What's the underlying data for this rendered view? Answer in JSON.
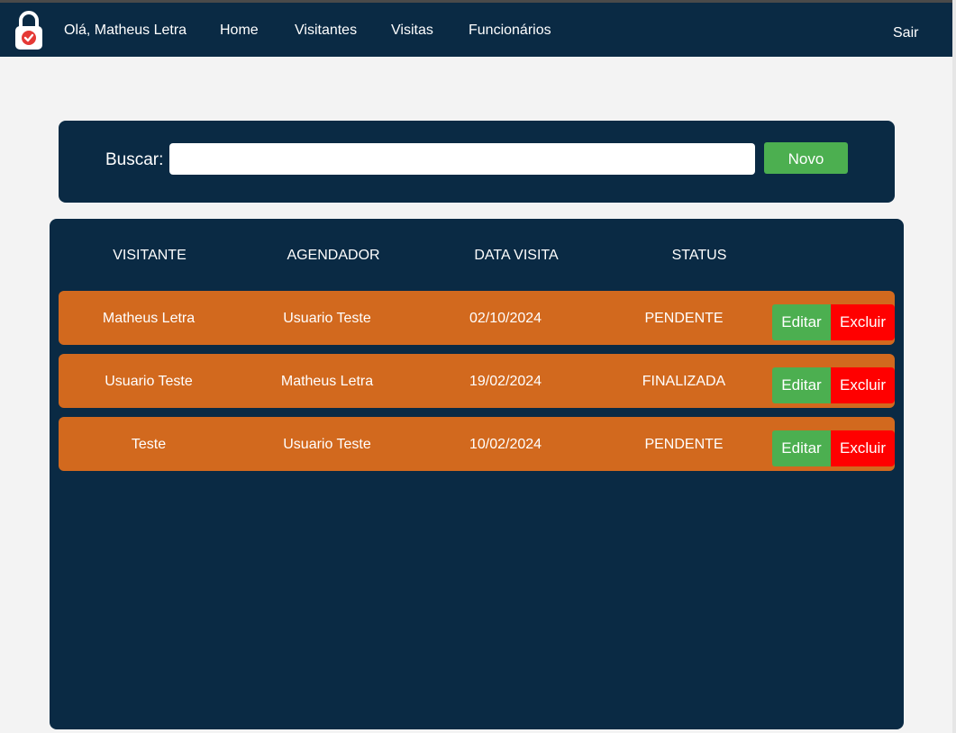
{
  "colors": {
    "navy": "#0a2a44",
    "background": "#f3f3f3",
    "row_orange": "#d2691e",
    "green": "#4caf50",
    "red": "#ff0000"
  },
  "navbar": {
    "logo_icon": "padlock-check-icon",
    "greeting": "Olá, Matheus Letra",
    "links": [
      "Home",
      "Visitantes",
      "Visitas",
      "Funcionários"
    ],
    "logout_label": "Sair"
  },
  "search": {
    "label": "Buscar:",
    "value": "",
    "placeholder": "",
    "new_button_label": "Novo"
  },
  "table": {
    "headers": [
      "VISITANTE",
      "AGENDADOR",
      "DATA VISITA",
      "STATUS"
    ],
    "rows": [
      {
        "visitante": "Matheus Letra",
        "agendador": "Usuario Teste",
        "data_visita": "02/10/2024",
        "status": "PENDENTE"
      },
      {
        "visitante": "Usuario Teste",
        "agendador": "Matheus Letra",
        "data_visita": "19/02/2024",
        "status": "FINALIZADA"
      },
      {
        "visitante": "Teste",
        "agendador": "Usuario Teste",
        "data_visita": "10/02/2024",
        "status": "PENDENTE"
      }
    ],
    "edit_label": "Editar",
    "delete_label": "Excluir"
  }
}
